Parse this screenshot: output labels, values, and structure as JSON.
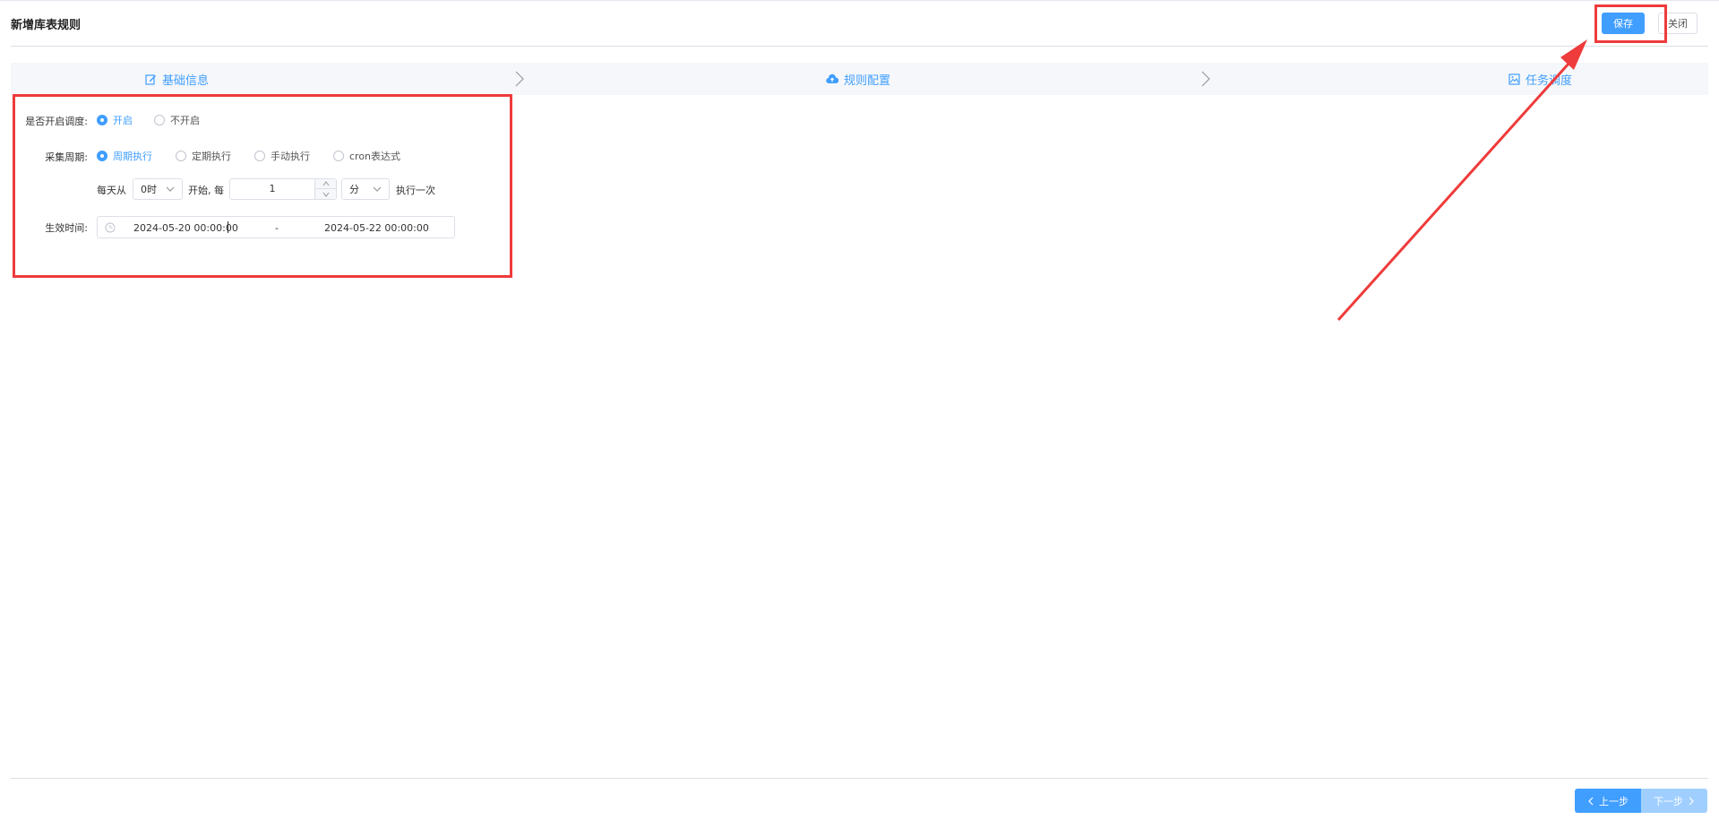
{
  "header": {
    "title": "新增库表规则",
    "save_label": "保存",
    "close_label": "关闭"
  },
  "steps": [
    {
      "label": "基础信息",
      "icon": "edit-icon"
    },
    {
      "label": "规则配置",
      "icon": "cloud-upload-icon"
    },
    {
      "label": "任务调度",
      "icon": "image-icon"
    }
  ],
  "form": {
    "schedule_label": "是否开启调度:",
    "schedule_options": [
      "开启",
      "不开启"
    ],
    "schedule_selected": "开启",
    "cycle_label": "采集周期:",
    "cycle_options": [
      "周期执行",
      "定期执行",
      "手动执行",
      "cron表达式"
    ],
    "cycle_selected": "周期执行",
    "daily_from": "每天从",
    "start_hour": "0时",
    "start_every": "开始, 每",
    "interval": "1",
    "unit": "分",
    "execute_once": "执行一次",
    "effective_label": "生效时间:",
    "start_time": "2024-05-20 00:00:00",
    "range_separator": "-",
    "end_time": "2024-05-22 00:00:00"
  },
  "footer": {
    "prev_label": "上一步",
    "next_label": "下一步"
  },
  "colors": {
    "primary": "#409eff",
    "primary_light": "#a0cfff",
    "annotation_red": "#ee3b3b"
  }
}
